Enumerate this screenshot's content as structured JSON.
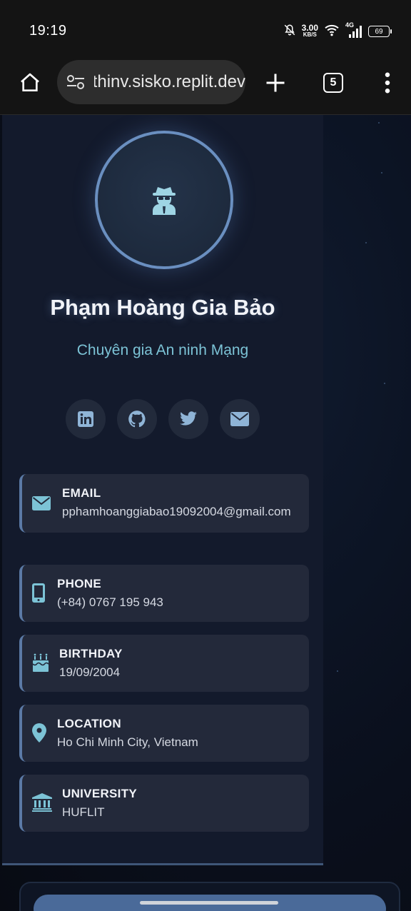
{
  "status_bar": {
    "time": "19:19",
    "net_speed_value": "3.00",
    "net_speed_unit": "KB/S",
    "network_type": "4G",
    "battery": "69",
    "icons": [
      "mute-icon",
      "wifi-icon",
      "signal-icon",
      "battery-icon"
    ]
  },
  "browser": {
    "url": "chuthinv.sisko.replit.dev",
    "tab_count": "5",
    "icons": [
      "home-icon",
      "site-settings-icon",
      "new-tab-icon",
      "tabs-icon",
      "more-menu-icon"
    ]
  },
  "profile": {
    "name": "Phạm Hoàng Gia Bảo",
    "title": "Chuyên gia An ninh Mạng",
    "avatar_icon": "user-secret-icon",
    "socials": [
      {
        "name": "linkedin",
        "icon": "linkedin-icon"
      },
      {
        "name": "github",
        "icon": "github-icon"
      },
      {
        "name": "twitter",
        "icon": "twitter-icon"
      },
      {
        "name": "email",
        "icon": "envelope-icon"
      }
    ]
  },
  "info": {
    "email": {
      "label": "EMAIL",
      "value": "pphamhoanggiabao19092004@gmail.co​m",
      "icon": "envelope-icon"
    },
    "phone": {
      "label": "PHONE",
      "value": "(+84) 0767 195 943",
      "icon": "mobile-icon"
    },
    "birthday": {
      "label": "BIRTHDAY",
      "value": "19/09/2004",
      "icon": "birthday-cake-icon"
    },
    "location": {
      "label": "LOCATION",
      "value": "Ho Chi Minh City, Vietnam",
      "icon": "map-marker-icon"
    },
    "university": {
      "label": "UNIVERSITY",
      "value": "HUFLIT",
      "icon": "university-icon"
    }
  },
  "colors": {
    "accent": "#7cc3d6",
    "card_border": "#5b7aa6",
    "card_bg": "#23293a",
    "sidebar_bg": "#131a2c"
  }
}
